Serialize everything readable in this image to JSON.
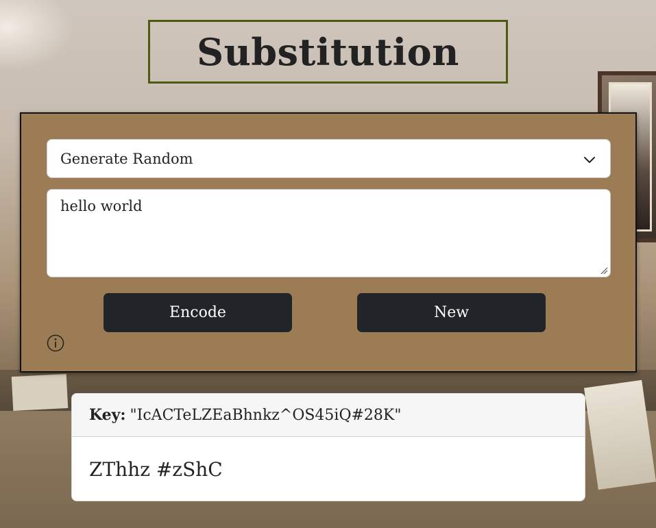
{
  "header": {
    "title": "Substitution"
  },
  "form": {
    "mode_select": {
      "selected": "Generate Random"
    },
    "input_text": "hello world",
    "encode_label": "Encode",
    "new_label": "New",
    "info_icon": "info-circle-icon"
  },
  "result": {
    "key_label": "Key:",
    "key_value": "\"IcACTeLZEaBhnkz^OS45iQ#28K\"",
    "output_text": "ZThhz #zShC"
  },
  "colors": {
    "title_border": "#4d5a12",
    "panel_bg": "#9c7c55",
    "button_bg": "#212529"
  }
}
